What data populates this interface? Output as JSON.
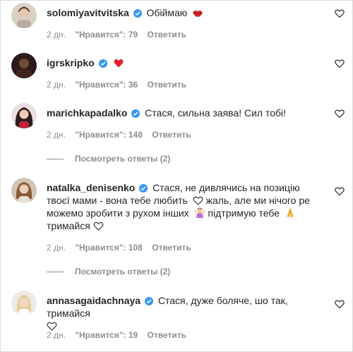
{
  "comments": [
    {
      "username": "solomiyavitvitska",
      "text": "Обіймаю",
      "emoji": "kiss-lips",
      "time": "2 дн.",
      "likes": "\"Нравится\": 79",
      "reply": "Ответить"
    },
    {
      "username": "igrskripko",
      "text": "",
      "emoji": "red-heart",
      "time": "2 дн.",
      "likes": "\"Нравится\": 36",
      "reply": "Ответить"
    },
    {
      "username": "marichkapadalko",
      "text": "Стася, сильна заява! Сил тобі!",
      "time": "2 дн.",
      "likes": "\"Нравится\": 148",
      "reply": "Ответить",
      "view_replies": "Посмотреть ответы (2)"
    },
    {
      "username": "natalka_denisenko",
      "text_parts": [
        "Стася, не дивлячись на позицію твоєї мами - вона тебе любить",
        "жаль, але ми нічого ре можемо зробити з рухом інших",
        "підтримую тебе",
        "тримайся"
      ],
      "time": "2 дн.",
      "likes": "\"Нравится\": 108",
      "reply": "Ответить",
      "view_replies": "Посмотреть ответы (2)"
    },
    {
      "username": "annasagaidachnaya",
      "text": "Стася, дуже боляче, шо так, тримайся",
      "time": "2 дн.",
      "likes": "\"Нравится\": 19",
      "reply": "Ответить"
    }
  ],
  "colors": {
    "verified": "#3897f0",
    "meta": "#8e8e8e",
    "text": "#262626"
  }
}
